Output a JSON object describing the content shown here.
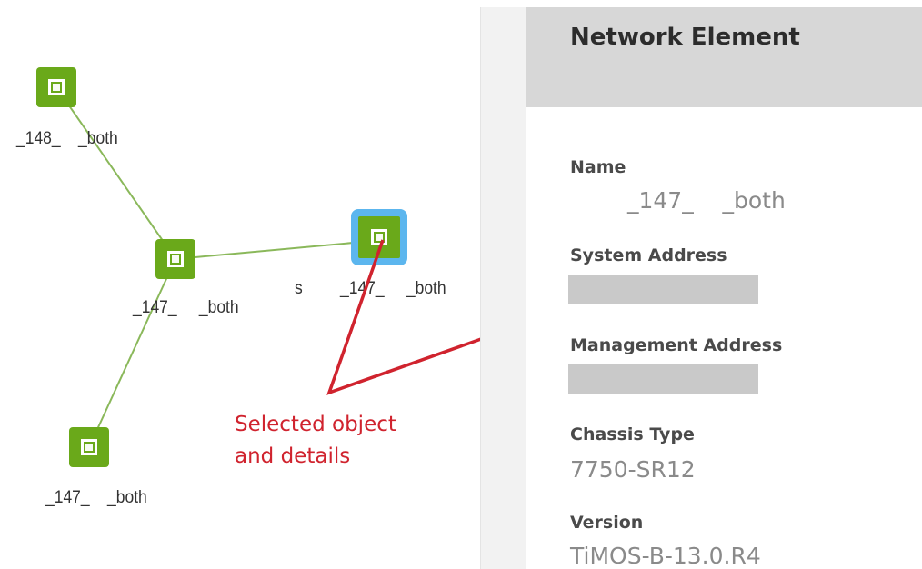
{
  "topology": {
    "nodes": [
      {
        "id": "n148",
        "label": "_148_    _both"
      },
      {
        "id": "n147a",
        "label": "_147_     _both"
      },
      {
        "id": "n147sel",
        "label": "_147_     _both",
        "prefix": "s"
      },
      {
        "id": "n147b",
        "label": "_147_    _both"
      }
    ]
  },
  "annotation": {
    "line1": "Selected object",
    "line2": "and details",
    "color": "#d0232e"
  },
  "panel": {
    "title": "Network Element",
    "name_label": "Name",
    "name_value": "_147_    _both",
    "system_address_label": "System Address",
    "management_address_label": "Management Address",
    "chassis_type_label": "Chassis Type",
    "chassis_type_value": "7750-SR12",
    "version_label": "Version",
    "version_value": "TiMOS-B-13.0.R4"
  },
  "colors": {
    "node_green": "#6aa91a",
    "selection_blue": "#5cb6ee",
    "link_green": "#8ab85a",
    "header_gray": "#d7d7d7"
  },
  "icons": {
    "node": "network-element-icon"
  }
}
